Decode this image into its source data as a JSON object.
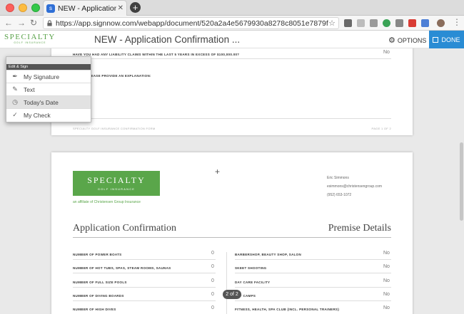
{
  "browser": {
    "tab_title": "NEW - Application Confirmatio",
    "url": "https://app.signnow.com/webapp/document/520a2a4e5679930a8278c8051e7879f36c8568ef?ro..."
  },
  "app": {
    "logo_main": "SPECIALTY",
    "logo_sub": "GOLF INSURANCE",
    "doc_title": "NEW - Application Confirmation ...",
    "options_label": "OPTIONS",
    "done_label": "DONE"
  },
  "page1": {
    "question1": "HAVE YOU HAD ANY LIABILITY CLAIMS WITHIN THE LAST 5 YEARS IN EXCESS OF $100,000.00?",
    "answer1": "No",
    "question2": "IF YES, PLEASE PROVIDE AN EXPLANATION:",
    "footer_left": "SPECIALTY GOLF INSURANCE CONFIRMATION FORM",
    "footer_right": "PAGE 1 OF 2"
  },
  "edit_sign": {
    "title": "Edit & Sign",
    "items": [
      {
        "label": "My Signature",
        "icon": "pen-nib-icon"
      },
      {
        "label": "Text",
        "icon": "pencil-icon"
      },
      {
        "label": "Today's Date",
        "icon": "clock-icon"
      },
      {
        "label": "My Check",
        "icon": "checkmark-icon"
      }
    ]
  },
  "page2": {
    "banner_main": "SPECIALTY",
    "banner_sub": "GOLF INSURANCE",
    "affiliate": "an affiliate of Christensen Group Insurance",
    "contact_name": "Eric Simmons",
    "contact_email": "esimmons@christensengroup.com",
    "contact_phone": "(952) 653-1072",
    "heading_left": "Application Confirmation",
    "heading_right": "Premise Details",
    "left_rows": [
      {
        "label": "NUMBER OF POWER BOATS",
        "value": "0"
      },
      {
        "label": "NUMBER OF HOT TUBS, SPAS, STEAM ROOMS, SAUNAS",
        "value": "0"
      },
      {
        "label": "NUMBER OF FULL SIZE POOLS",
        "value": "0"
      },
      {
        "label": "NUMBER OF DIVING BOARDS",
        "value": "0"
      },
      {
        "label": "NUMBER OF HIGH DIVES",
        "value": "0"
      }
    ],
    "right_rows": [
      {
        "label": "BARBERSHOP, BEAUTY SHOP, SALON",
        "value": "No"
      },
      {
        "label": "SKEET SHOOTING",
        "value": "No"
      },
      {
        "label": "DAY CARE FACILITY",
        "value": "No"
      },
      {
        "label": "DAY CAMPS",
        "value": "No"
      },
      {
        "label": "FITNESS, HEALTH, SPA CLUB (INCL. PERSONAL TRAINERS)",
        "value": "No"
      }
    ]
  },
  "page_indicator": "2 of 2"
}
